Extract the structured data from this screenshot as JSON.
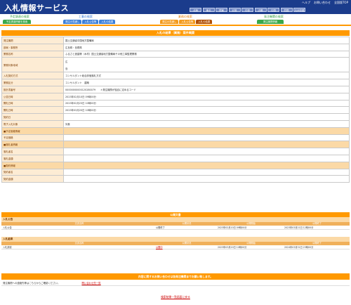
{
  "header": {
    "title": "入札情報サービス",
    "links": [
      "ヘルプ",
      "お問い合わせ",
      "全国版TOP"
    ],
    "regions": [
      "北海",
      "東北",
      "関東",
      "北陸",
      "中部",
      "近畿",
      "中国",
      "四国",
      "九州沖縄"
    ]
  },
  "nav": {
    "g1": {
      "title": "予定調達の検索",
      "tabs": [
        "予定調達情報を検索"
      ]
    },
    "g2": {
      "title": "工事の検索",
      "tabs": [
        "発注の見通し",
        "入札公告等",
        "入札の結果"
      ]
    },
    "g3": {
      "title": "業務の検索",
      "tabs": [
        "発注の見通し",
        "入札公告等",
        "入札の結果"
      ]
    },
    "g4": {
      "title": "発注機関の検索",
      "tabs": [
        "発注機関情報"
      ]
    }
  },
  "page_title": "入札の結果（業務）案件概要",
  "details": [
    {
      "k": "発注機関",
      "v": "国土交通省中国地方整備局"
    },
    {
      "k": "部局・事務所",
      "v": "広島県・島根県"
    },
    {
      "k": "業務名称",
      "v": "ふるさと造園等（木材）国土交通省地方整備局その他工事監理業務"
    },
    {
      "k": "業務対象地域",
      "v": "広",
      "v2": "島"
    },
    {
      "k": "入札契約方式",
      "v": "コンサルタント総合評価落札方式"
    },
    {
      "k": "業務区分",
      "v": "コンサルタント　建築"
    },
    {
      "k": "設計書番号",
      "v": "00000000000120280079　　＊発注機関が独自に定めるコード"
    },
    {
      "k": "公告日時",
      "v": "2023年02月10日 09時00分"
    },
    {
      "k": "開札日時",
      "v": "2023年02月23日 10時00分"
    },
    {
      "k": "開札日時",
      "v": "2023年03月20日 10時00分"
    },
    {
      "k": "契約日",
      "v": ""
    },
    {
      "k": "電子入札対象",
      "v": "対象"
    },
    {
      "k": "■予定価格情報",
      "v": "",
      "sub": true
    },
    {
      "k": "予定価格",
      "v": ""
    },
    {
      "k": "■落札者情報",
      "v": "",
      "sub": true
    },
    {
      "k": "落札者名",
      "v": ""
    },
    {
      "k": "落札金額",
      "v": ""
    },
    {
      "k": "■契約情報",
      "v": "",
      "sub": true
    },
    {
      "k": "契約者名",
      "v": ""
    },
    {
      "k": "契約金額",
      "v": ""
    }
  ],
  "publish": {
    "title": "公開文書",
    "cols": [
      "文書名称",
      "公開状況",
      "公開開始",
      "公開終了"
    ],
    "g1": {
      "label": "入札公告",
      "rows": [
        [
          "入札公告",
          "公開終了",
          "2023年02月10日 09時00分",
          "2023年03月21日 12時00分"
        ]
      ]
    },
    "g2": {
      "label": "入札結果",
      "rows": [
        [
          "入札調書",
          "公開中",
          "2023年03月20日 10時00分",
          "2024年03月31日 23時00分"
        ]
      ]
    }
  },
  "contact": {
    "title": "内容に関するお問い合わせは各発注機関までお願い致します。",
    "text": "発注機関への連絡先等はこちらからご確認ください。",
    "link": "問い合わせ先一覧"
  },
  "back": "検索結果一覧画面に戻る"
}
